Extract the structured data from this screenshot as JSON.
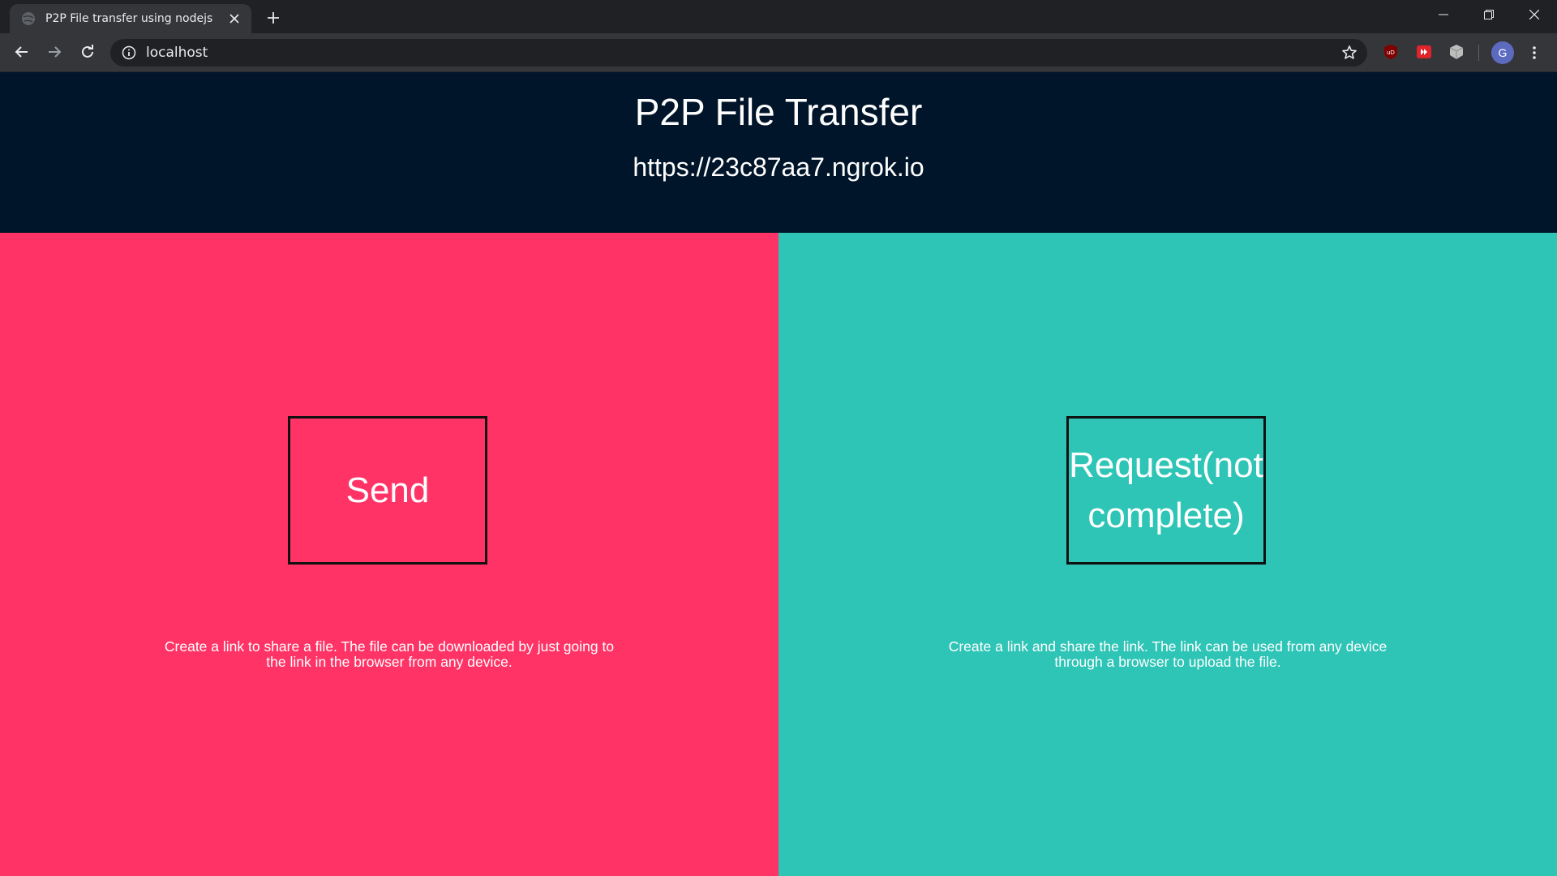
{
  "browser": {
    "tab_title": "P2P File transfer using nodejs",
    "url": "localhost",
    "profile_initial": "G"
  },
  "page": {
    "title": "P2P File Transfer",
    "share_url": "https://23c87aa7.ngrok.io",
    "send": {
      "label": "Send",
      "description": "Create a link to share a file. The file can be downloaded by just going to the link in the browser from any device.",
      "color": "#ff3366"
    },
    "request": {
      "label": "Request(not complete)",
      "description": "Create a link and share the link. The link can be used from any device through a browser to upload the file.",
      "color": "#2ec4b6"
    },
    "header_color": "#001529"
  },
  "icons": {
    "tab_favicon": "globe-icon",
    "tab_close": "close-icon",
    "new_tab": "plus-icon",
    "back": "arrow-left-icon",
    "forward": "arrow-right-icon",
    "reload": "reload-icon",
    "site_info": "info-icon",
    "bookmark": "star-icon",
    "extensions": [
      "ublock-icon",
      "video-speed-icon",
      "cube-icon"
    ],
    "menu": "kebab-menu-icon"
  }
}
